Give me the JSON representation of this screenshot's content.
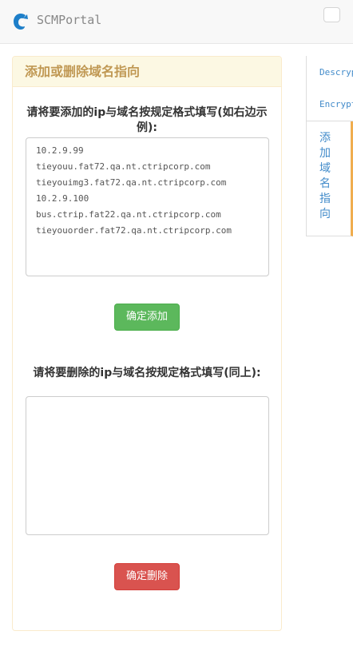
{
  "app": {
    "brand": "SCMPortal"
  },
  "panel": {
    "title": "添加或删除域名指向",
    "add_label": "请将要添加的ip与域名按规定格式填写(如右边示例):",
    "add_lines": [
      "10.2.9.99",
      "tieyouu.fat72.qa.nt.ctripcorp.com",
      "tieyouimg3.fat72.qa.nt.ctripcorp.com",
      "10.2.9.100",
      "bus.ctrip.fat22.qa.nt.ctripcorp.com",
      "tieyouorder.fat72.qa.nt.ctripcorp.com"
    ],
    "add_button": "确定添加",
    "delete_label": "请将要删除的ip与域名按规定格式填写(同上):",
    "delete_value": "",
    "delete_button": "确定删除"
  },
  "side_tabs": {
    "items": [
      "Descrypt",
      "Encrypt",
      "添加域名指向"
    ],
    "active": 2
  },
  "colors": {
    "success": "#5cb85c",
    "danger": "#d9534f",
    "warning_heading": "#c09853",
    "active_tab_border": "#f0ad4e"
  },
  "icons": {
    "logo": "dolphin-logo-icon"
  }
}
